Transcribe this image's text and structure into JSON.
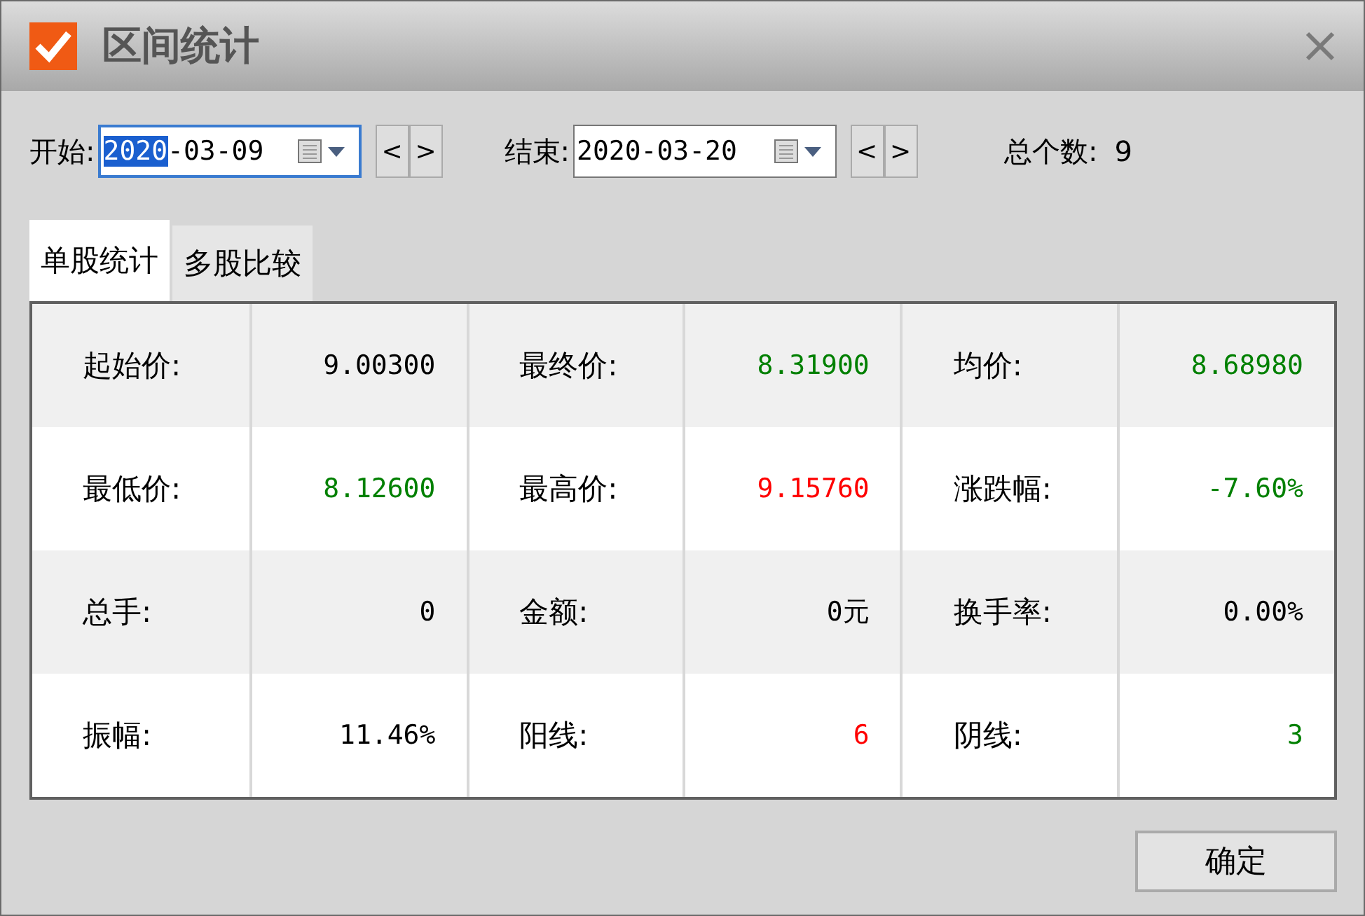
{
  "window": {
    "title": "区间统计"
  },
  "range": {
    "start": {
      "label": "开始:",
      "selected_text": "2020",
      "text": "-03-09",
      "focused": true
    },
    "end": {
      "label": "结束:",
      "text": "2020-03-20",
      "focused": false
    },
    "prev": "<",
    "next": ">",
    "count_label": "总个数:",
    "count": "9"
  },
  "tabs": [
    {
      "label": "单股统计",
      "selected": true
    },
    {
      "label": "多股比较",
      "selected": false
    }
  ],
  "stats": [
    [
      {
        "label": "起始价:",
        "value": "9.00300",
        "color": "#000000"
      },
      {
        "label": "最终价:",
        "value": "8.31900",
        "color": "#008000"
      },
      {
        "label": "均价:",
        "value": "8.68980",
        "color": "#008000"
      }
    ],
    [
      {
        "label": "最低价:",
        "value": "8.12600",
        "color": "#008000"
      },
      {
        "label": "最高价:",
        "value": "9.15760",
        "color": "#ff0000"
      },
      {
        "label": "涨跌幅:",
        "value": "-7.60%",
        "color": "#008000"
      }
    ],
    [
      {
        "label": "总手:",
        "value": "0",
        "color": "#000000"
      },
      {
        "label": "金额:",
        "value": "0元",
        "color": "#000000"
      },
      {
        "label": "换手率:",
        "value": "0.00%",
        "color": "#000000"
      }
    ],
    [
      {
        "label": "振幅:",
        "value": "11.46%",
        "color": "#000000"
      },
      {
        "label": "阳线:",
        "value": "6",
        "color": "#ff0000"
      },
      {
        "label": "阴线:",
        "value": "3",
        "color": "#008000"
      }
    ]
  ],
  "buttons": [
    "确定"
  ]
}
